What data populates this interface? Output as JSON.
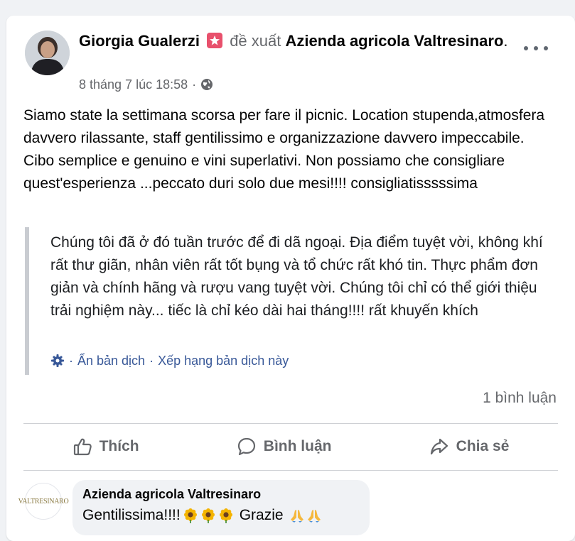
{
  "post": {
    "author": "Giorgia Gualerzi",
    "recommends_label": "đề xuất",
    "page_name": "Azienda agricola Valtresinaro",
    "name_suffix": ".",
    "timestamp": "8 tháng 7 lúc 18:58",
    "separator": "·",
    "original_text": "Siamo state la settimana scorsa per fare il picnic. Location stupenda,atmosfera davvero rilassante, staff gentilissimo e organizzazione davvero impeccabile. Cibo semplice e genuino e vini superlativi. Non possiamo che consigliare quest'esperienza ...peccato duri solo due mesi!!!! consigliatisssssima",
    "translated_text": "Chúng tôi đã ở đó tuần trước để đi dã ngoại. Địa điểm tuyệt vời, không khí rất thư giãn, nhân viên rất tốt bụng và tổ chức rất khó tin. Thực phẩm đơn giản và chính hãng và rượu vang tuyệt vời. Chúng tôi chỉ có thể giới thiệu trải nghiệm này... tiếc là chỉ kéo dài hai tháng!!!! rất khuyến khích",
    "hide_translation": "Ẩn bản dịch",
    "rate_translation": "Xếp hạng bản dịch này",
    "comment_count": "1 bình luận"
  },
  "actions": {
    "like": "Thích",
    "comment": "Bình luận",
    "share": "Chia sẻ"
  },
  "comment": {
    "author": "Azienda agricola Valtresinaro",
    "text": "Gentilissima!!!!",
    "text_after": "Grazie",
    "avatar_logo_text": "VALTRESINARO"
  },
  "icons": {
    "recommend_badge": "star-badge-icon",
    "privacy": "globe-icon",
    "more": "more-horizontal-icon",
    "translate_settings": "gear-icon",
    "like": "thumbs-up-icon",
    "comment": "speech-bubble-icon",
    "share": "share-arrow-icon",
    "flower_emoji": "sunflower-icon",
    "pray_emoji": "folded-hands-icon"
  },
  "colors": {
    "link_blue": "#385898",
    "secondary_text": "#65676b",
    "badge_pink": "#e8506c"
  }
}
